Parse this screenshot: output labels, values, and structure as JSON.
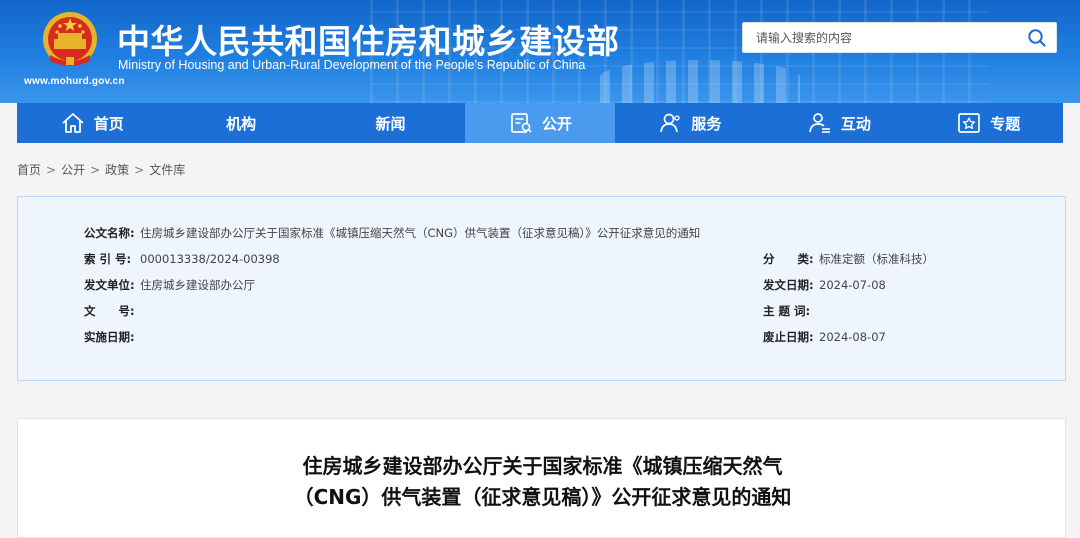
{
  "header": {
    "title_cn": "中华人民共和国住房和城乡建设部",
    "title_en": "Ministry of Housing and Urban-Rural Development of the People’s Republic of China",
    "site_url": "www.mohurd.gov.cn",
    "search_placeholder": "请输入搜索的内容",
    "colors": {
      "header_blue": "#1f7fe0",
      "nav_blue": "#1b6fd6",
      "nav_active": "#4a9af0"
    }
  },
  "nav": {
    "items": [
      {
        "label": "首页",
        "icon": "home-icon"
      },
      {
        "label": "机构",
        "icon": ""
      },
      {
        "label": "新闻",
        "icon": ""
      },
      {
        "label": "公开",
        "icon": "document-icon",
        "active": true
      },
      {
        "label": "服务",
        "icon": "user-service-icon"
      },
      {
        "label": "互动",
        "icon": "interaction-icon"
      },
      {
        "label": "专题",
        "icon": "star-icon"
      }
    ]
  },
  "breadcrumb": [
    "首页",
    "公开",
    "政策",
    "文件库"
  ],
  "info": {
    "name_label": "公文名称:",
    "name_value": "住房城乡建设部办公厅关于国家标准《城镇压缩天然气（CNG）供气装置（征求意见稿）》公开征求意见的通知",
    "index_label": "索 引 号:",
    "index_value": "000013338/2024-00398",
    "issuer_label": "发文单位:",
    "issuer_value": "住房城乡建设部办公厅",
    "docno_label": "文　　号:",
    "docno_value": "",
    "effective_label": "实施日期:",
    "effective_value": "",
    "category_label": "分　　类:",
    "category_value": "标准定额（标准科技）",
    "issue_date_label": "发文日期:",
    "issue_date_value": "2024-07-08",
    "subject_label": "主 题 词:",
    "subject_value": "",
    "expiry_label": "废止日期:",
    "expiry_value": "2024-08-07"
  },
  "article": {
    "title_line1": "住房城乡建设部办公厅关于国家标准《城镇压缩天然气",
    "title_line2": "（CNG）供气装置（征求意见稿）》公开征求意见的通知"
  }
}
